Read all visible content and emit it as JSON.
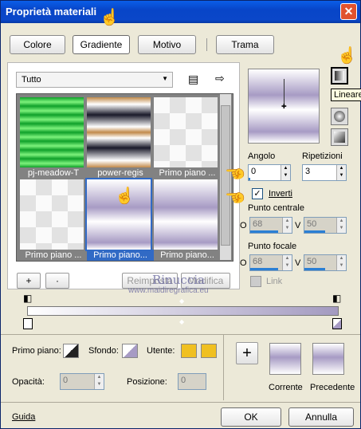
{
  "window": {
    "title": "Proprietà materiali",
    "close": "✕"
  },
  "tabs": [
    "Colore",
    "Gradiente",
    "Motivo",
    "Trama"
  ],
  "category": "Tutto",
  "tiles": [
    {
      "label": "pj-meadow-T",
      "selected": false
    },
    {
      "label": "power-regis",
      "selected": false
    },
    {
      "label": "Primo piano ...",
      "selected": false
    },
    {
      "label": "Primo piano ...",
      "selected": false
    },
    {
      "label": "Primo piano...",
      "selected": true
    },
    {
      "label": "Primo piano...",
      "selected": false
    }
  ],
  "buttons": {
    "add": "+",
    "remove": "·",
    "reset": "Reimposta",
    "edit": "Modifica",
    "ok": "OK",
    "cancel": "Annulla",
    "help": "Guida",
    "plus_big": "+"
  },
  "tooltip": "Lineare",
  "labels": {
    "angle": "Angolo",
    "repeat": "Ripetizioni",
    "invert": "Inverti",
    "center": "Punto centrale",
    "focal": "Punto focale",
    "link": "Link",
    "o": "O",
    "v": "V"
  },
  "values": {
    "angle": "0",
    "repeat": "3",
    "center_o": "68",
    "center_v": "50",
    "focal_o": "68",
    "focal_v": "50",
    "opacity": "0",
    "position": "0",
    "invert_checked": "✓"
  },
  "bottom": {
    "foreground": "Primo piano:",
    "background": "Sfondo:",
    "user": "Utente:",
    "opacity": "Opacità:",
    "position": "Posizione:",
    "current": "Corrente",
    "previous": "Precedente"
  },
  "watermark": {
    "name": "Rinuccia",
    "url": "www.maidiregrafica.eu"
  },
  "colors": {
    "accent": "#316ac5",
    "title": "#0a5ee8",
    "user": "#f0c020"
  }
}
